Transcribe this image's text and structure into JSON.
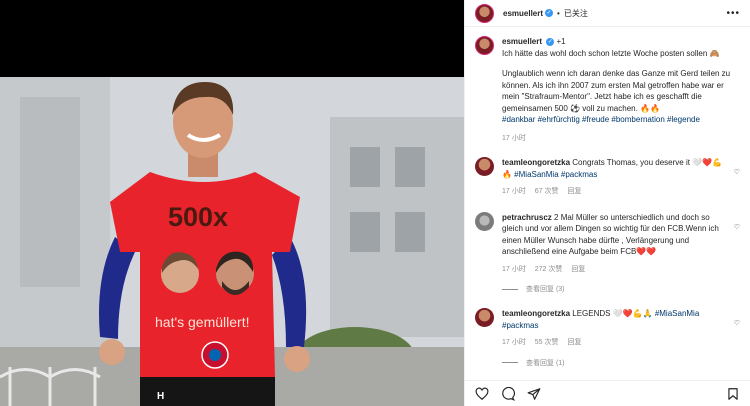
{
  "header": {
    "username": "esmuellert",
    "follow_status": "已关注",
    "more": "•••"
  },
  "caption": {
    "username": "esmuellert",
    "collab": "+1",
    "line1": "Ich hätte das wohl doch schon letzte Woche posten sollen 🙈",
    "line2": "Unglaublich wenn ich daran denke das Ganze mit Gerd teilen zu können. Als ich ihn 2007 zum ersten Mal getroffen habe war er mein \"Strafraum-Mentor\". Jetzt habe ich es geschafft die gemeinsamen 500 ⚽ voll zu machen. 🔥🔥",
    "hashtags": "#dankbar #ehrfürchtig #freude #bombernation #legende",
    "time": "17 小时"
  },
  "comments": [
    {
      "username": "teamleongoretzka",
      "text": "Congrats Thomas, you deserve it 🤍❤️💪",
      "hashtags": "🔥 #MiaSanMia #packmas",
      "time": "17 小时",
      "likes": "67 次赞",
      "reply": "回复",
      "replies": ""
    },
    {
      "username": "petrachruscz",
      "text": "2 Mal Müller so unterschiedlich und doch so gleich und vor allem Dingen so wichtig für den FCB.Wenn ich einen Müller Wunsch habe dürfte , Verlängerung und anschließend eine Aufgabe beim FCB❤️❤️",
      "hashtags": "",
      "time": "17 小时",
      "likes": "272 次赞",
      "reply": "回复",
      "replies": "查看回复 (3)"
    },
    {
      "username": "teamleongoretzka",
      "text": "LEGENDS 🤍❤️💪🙏",
      "hashtags": "#MiaSanMia #packmas",
      "time": "17 小时",
      "likes": "55 次赞",
      "reply": "回复",
      "replies": "查看回复 (1)"
    }
  ],
  "photo": {
    "shirt_line1": "500x",
    "shirt_line2": "hat's gemüllert!",
    "shirt_color": "#e8232b"
  },
  "actions": {
    "icons": [
      "heart-icon",
      "comment-icon",
      "share-icon",
      "bookmark-icon"
    ]
  },
  "colors": {
    "link": "#00376b",
    "verified": "#3897f0",
    "muted": "#8e8e8e"
  }
}
